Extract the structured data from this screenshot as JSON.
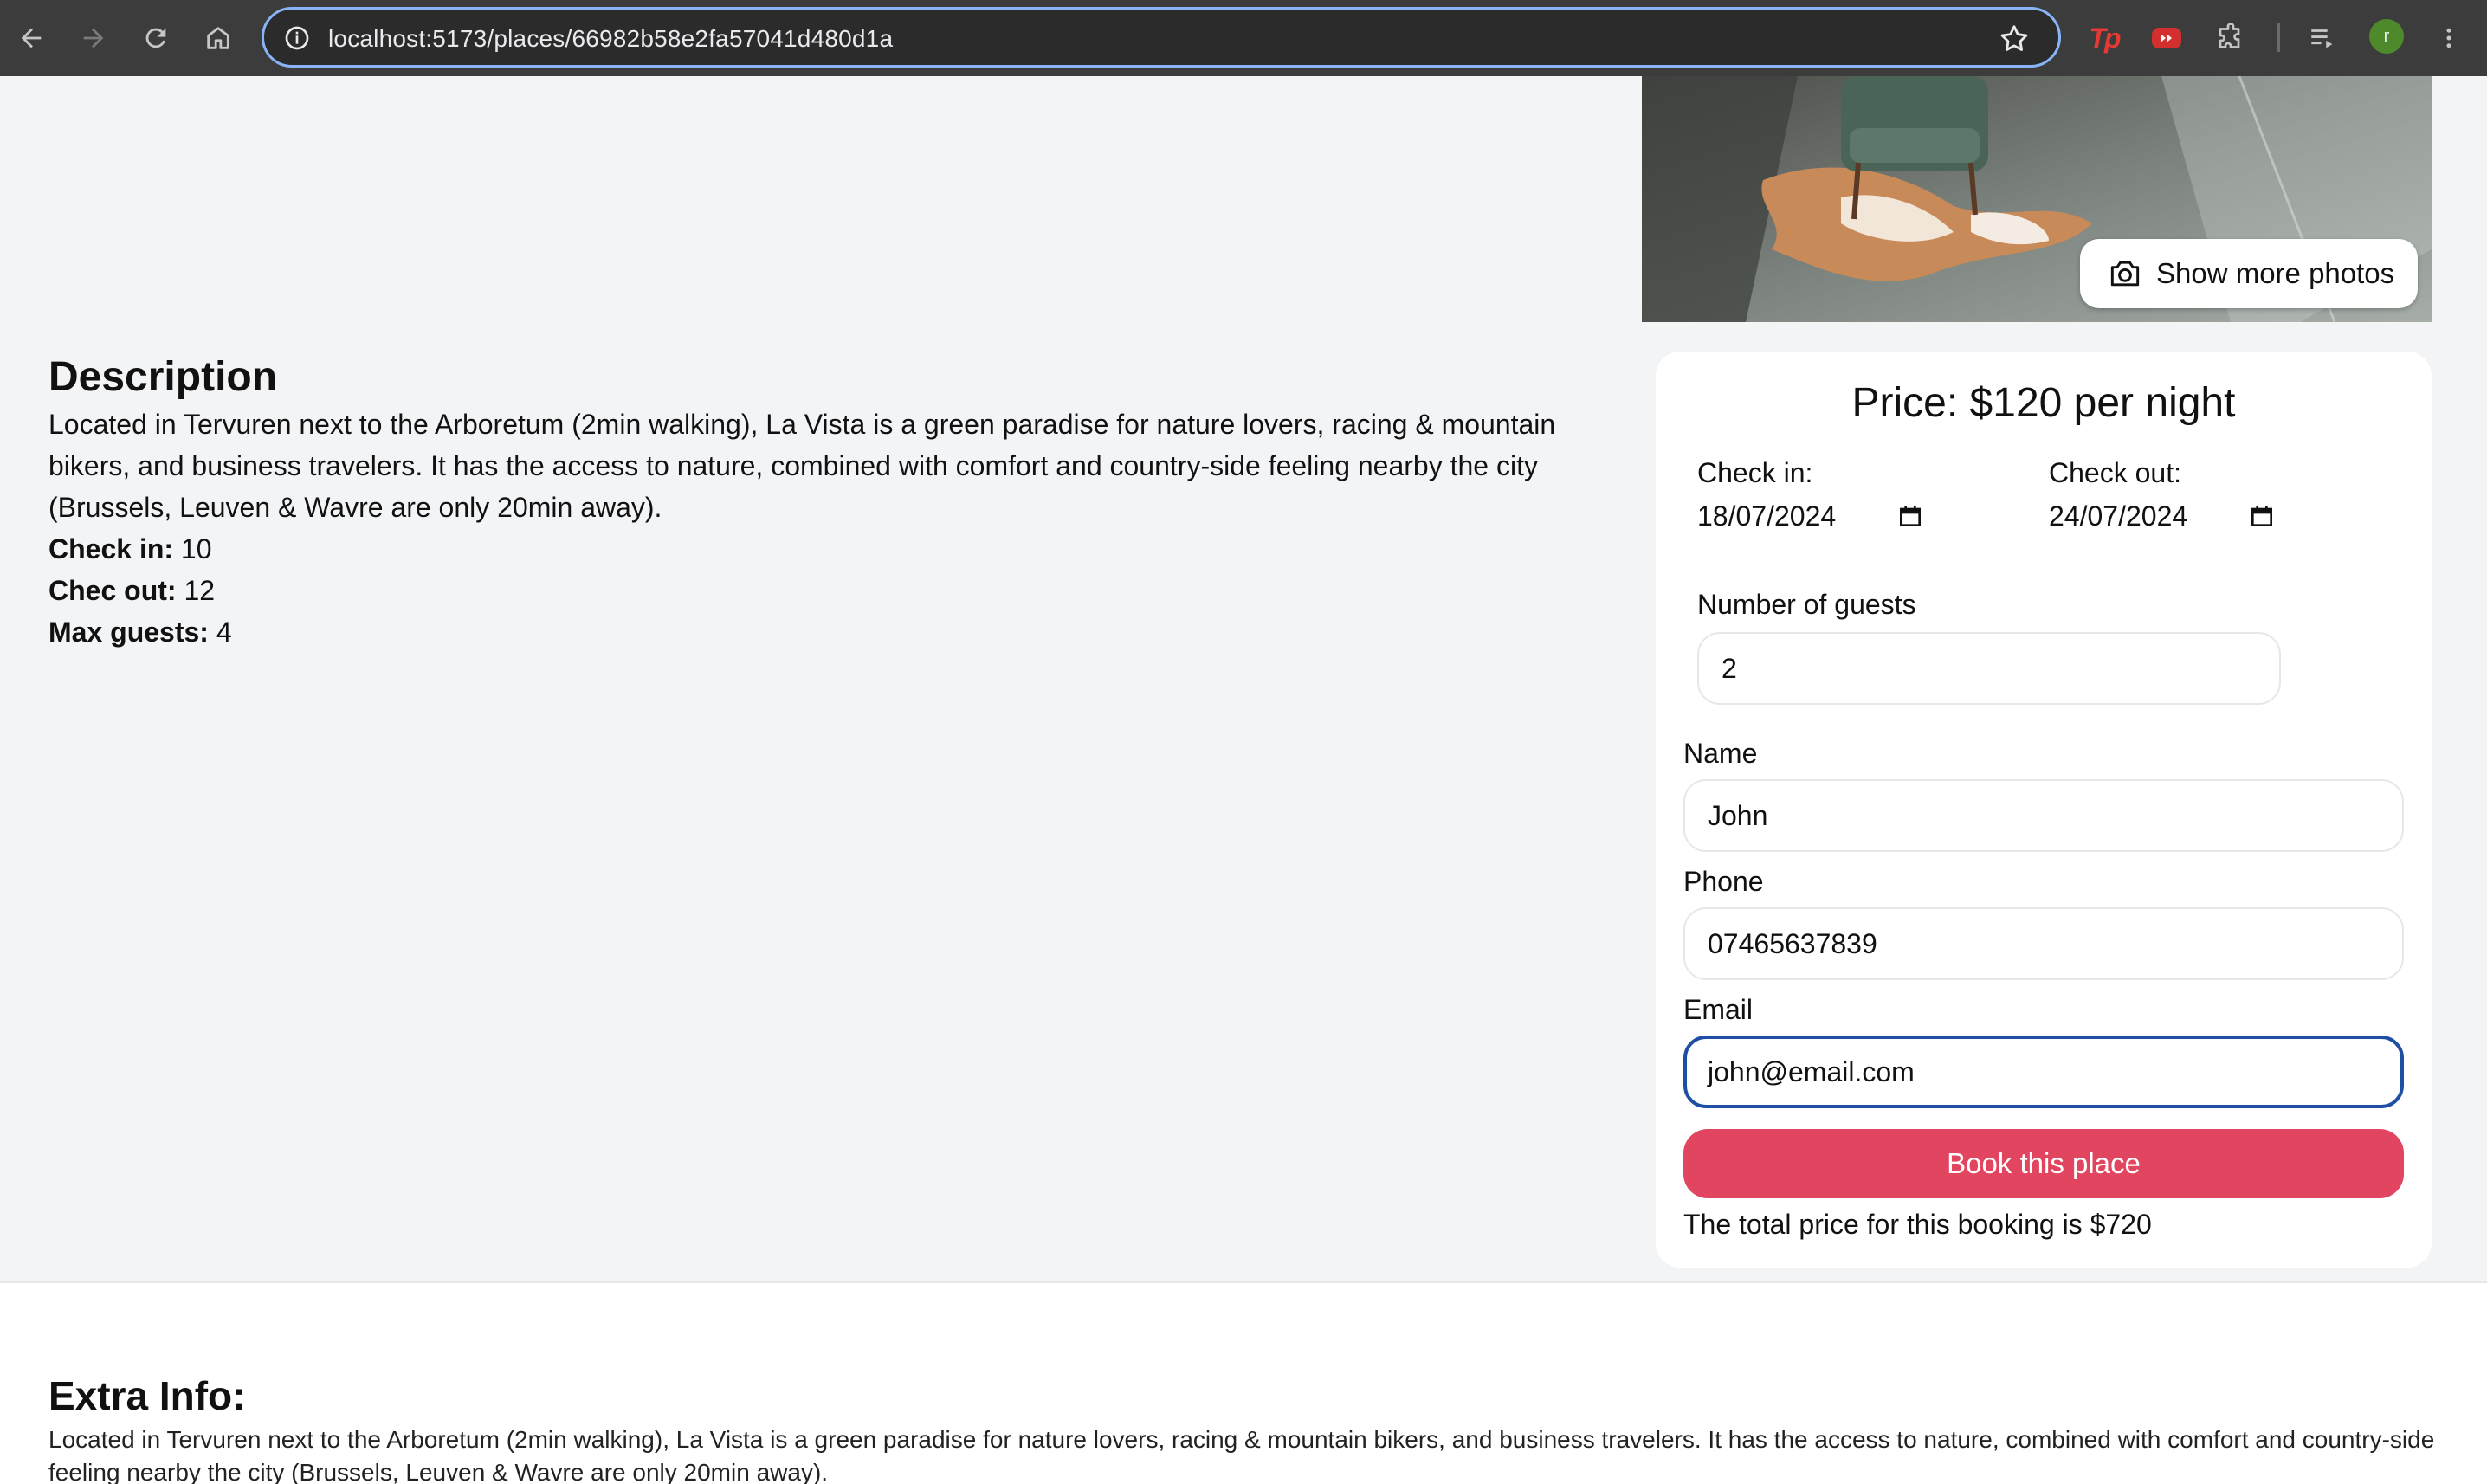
{
  "browser": {
    "url": "localhost:5173/places/66982b58e2fa57041d480d1a",
    "profile_initial": "r",
    "extensions": [
      "Tp",
      "video-extension",
      "puzzle-extensions"
    ]
  },
  "place": {
    "show_photos_label": "Show more photos",
    "description_heading": "Description",
    "description": "Located in Tervuren next to the Arboretum (2min walking), La Vista is a green paradise for nature lovers, racing & mountain bikers, and business travelers. It has the access to nature, combined with comfort and country-side feeling nearby the city (Brussels, Leuven & Wavre are only 20min away).",
    "check_in_label": "Check in:",
    "check_in_value": "10",
    "check_out_label": "Chec out:",
    "check_out_value": "12",
    "max_guests_label": "Max guests:",
    "max_guests_value": "4"
  },
  "booking": {
    "price_text": "Price: $120 per night",
    "check_in_label": "Check in:",
    "check_in_date": "18/07/2024",
    "check_out_label": "Check out:",
    "check_out_date": "24/07/2024",
    "guests_label": "Number of guests",
    "guests_value": "2",
    "name_label": "Name",
    "name_value": "John",
    "phone_label": "Phone",
    "phone_value": "07465637839",
    "email_label": "Email",
    "email_value": "john@email.com",
    "button_label": "Book this place",
    "total_text": "The total price for this booking is $720"
  },
  "extra": {
    "title": "Extra Info:",
    "text": "Located in Tervuren next to the Arboretum (2min walking), La Vista is a green paradise for nature lovers, racing & mountain bikers, and business travelers. It has the access to nature, combined with comfort and country-side feeling nearby the city (Brussels, Leuven & Wavre are only 20min away)."
  },
  "colors": {
    "accent": "#e2455f",
    "focus_ring": "#1e4fa3",
    "chrome_bg": "#3c3c3c",
    "page_bg": "#f3f4f6"
  }
}
